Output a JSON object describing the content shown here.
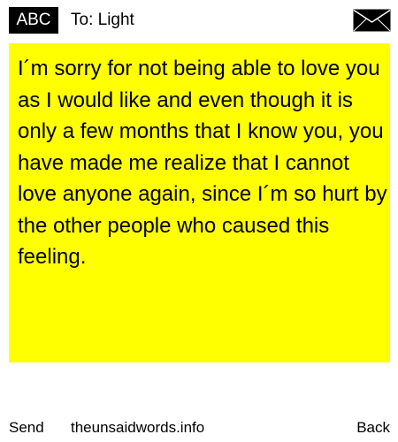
{
  "header": {
    "badge_label": "ABC",
    "to_text": "To: Light",
    "mail_icon": "envelope-icon"
  },
  "message": {
    "body": "I´m sorry for not being able to love you as I would like and even though it is only a few months that I know you, you have made me realize that I cannot love anyone again, since I´m so hurt by the other people who caused this feeling."
  },
  "footer": {
    "send_label": "Send",
    "site_label": "theunsaidwords.info",
    "back_label": "Back"
  },
  "colors": {
    "message_background": "#ffff00",
    "badge_background": "#000000",
    "badge_text": "#ffffff"
  }
}
